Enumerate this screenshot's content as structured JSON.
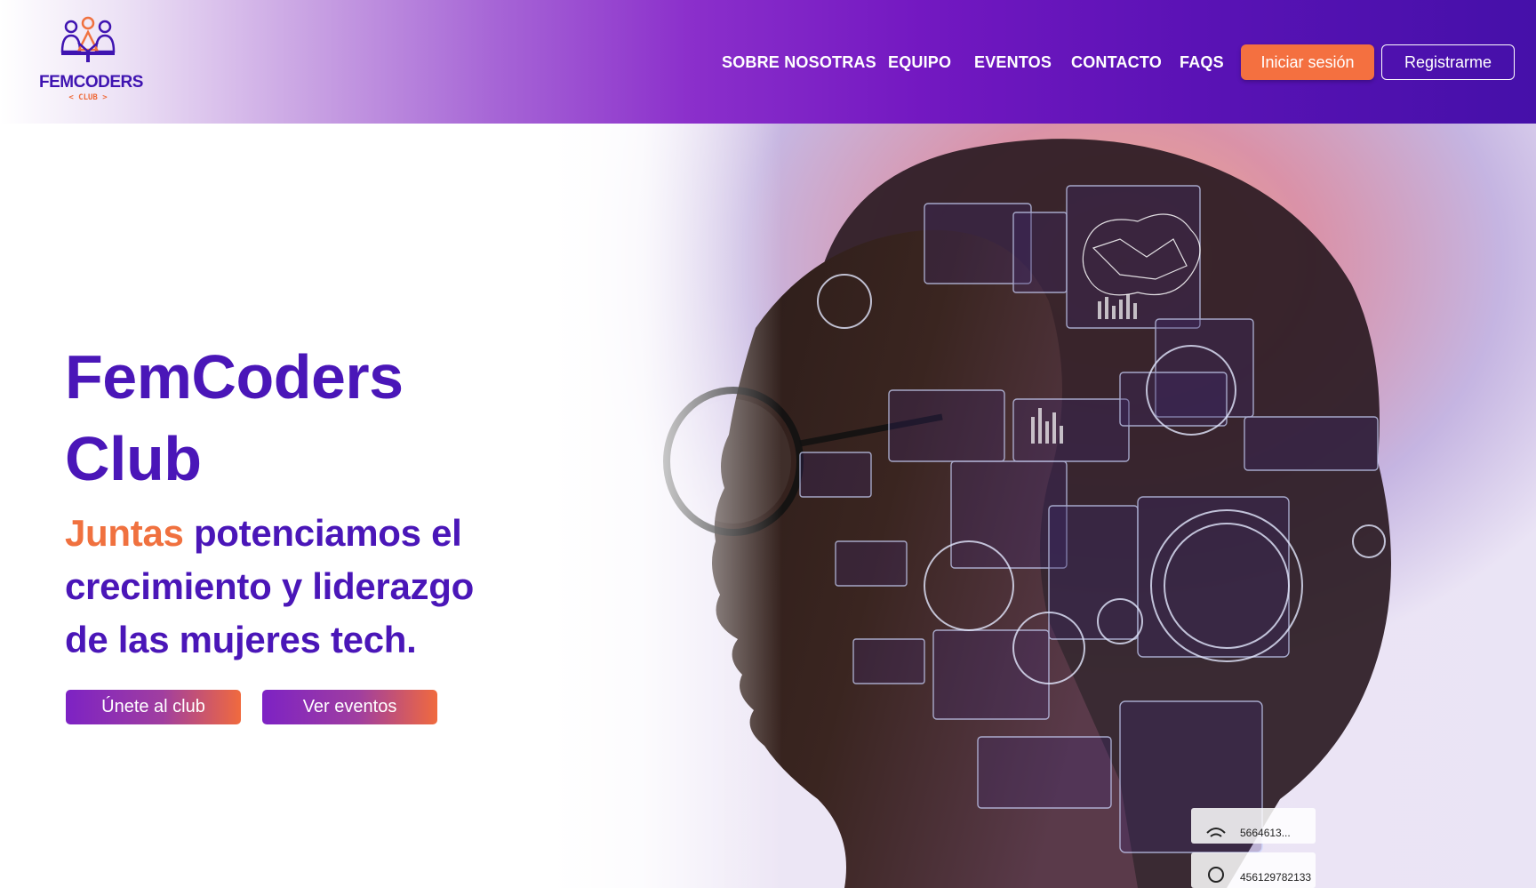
{
  "brand": {
    "name": "FEMCODERS",
    "sub": "< CLUB >"
  },
  "nav": {
    "items": [
      {
        "label": "SOBRE NOSOTRAS"
      },
      {
        "label": "EQUIPO"
      },
      {
        "label": "EVENTOS"
      },
      {
        "label": "CONTACTO"
      },
      {
        "label": "FAQS"
      }
    ],
    "login_label": "Iniciar sesión",
    "register_label": "Registrarme"
  },
  "hero": {
    "title_line1": "FemCoders",
    "title_line2": "Club",
    "subtitle_accent": "Juntas",
    "subtitle_rest1": " potenciamos el",
    "subtitle_line2": "crecimiento y liderazgo",
    "subtitle_line3": "de las mujeres tech.",
    "cta_primary": "Únete al club",
    "cta_secondary": "Ver eventos",
    "image_ids": [
      "5664613...",
      "456129782133"
    ]
  },
  "colors": {
    "brand_purple": "#4a16b8",
    "accent_orange": "#f0713f",
    "header_end": "#4510a9"
  }
}
